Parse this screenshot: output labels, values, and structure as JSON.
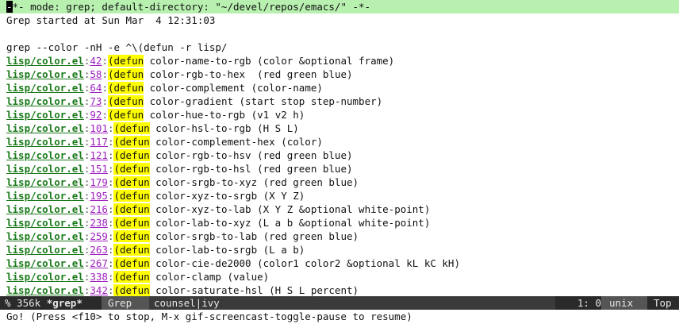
{
  "header": {
    "cursor_char": "-",
    "text": "*- mode: grep; default-directory: \"~/devel/repos/emacs/\" -*-"
  },
  "started": "Grep started at Sun Mar  4 12:31:03",
  "command": "grep --color -nH -e ^\\(defun -r lisp/",
  "results": [
    {
      "file": "lisp/color.el",
      "line": "42",
      "match": "(defun",
      "rest": " color-name-to-rgb (color &optional frame)"
    },
    {
      "file": "lisp/color.el",
      "line": "58",
      "match": "(defun",
      "rest": " color-rgb-to-hex  (red green blue)"
    },
    {
      "file": "lisp/color.el",
      "line": "64",
      "match": "(defun",
      "rest": " color-complement (color-name)"
    },
    {
      "file": "lisp/color.el",
      "line": "73",
      "match": "(defun",
      "rest": " color-gradient (start stop step-number)"
    },
    {
      "file": "lisp/color.el",
      "line": "92",
      "match": "(defun",
      "rest": " color-hue-to-rgb (v1 v2 h)"
    },
    {
      "file": "lisp/color.el",
      "line": "101",
      "match": "(defun",
      "rest": " color-hsl-to-rgb (H S L)"
    },
    {
      "file": "lisp/color.el",
      "line": "117",
      "match": "(defun",
      "rest": " color-complement-hex (color)"
    },
    {
      "file": "lisp/color.el",
      "line": "121",
      "match": "(defun",
      "rest": " color-rgb-to-hsv (red green blue)"
    },
    {
      "file": "lisp/color.el",
      "line": "151",
      "match": "(defun",
      "rest": " color-rgb-to-hsl (red green blue)"
    },
    {
      "file": "lisp/color.el",
      "line": "179",
      "match": "(defun",
      "rest": " color-srgb-to-xyz (red green blue)"
    },
    {
      "file": "lisp/color.el",
      "line": "195",
      "match": "(defun",
      "rest": " color-xyz-to-srgb (X Y Z)"
    },
    {
      "file": "lisp/color.el",
      "line": "216",
      "match": "(defun",
      "rest": " color-xyz-to-lab (X Y Z &optional white-point)"
    },
    {
      "file": "lisp/color.el",
      "line": "238",
      "match": "(defun",
      "rest": " color-lab-to-xyz (L a b &optional white-point)"
    },
    {
      "file": "lisp/color.el",
      "line": "259",
      "match": "(defun",
      "rest": " color-srgb-to-lab (red green blue)"
    },
    {
      "file": "lisp/color.el",
      "line": "263",
      "match": "(defun",
      "rest": " color-lab-to-srgb (L a b)"
    },
    {
      "file": "lisp/color.el",
      "line": "267",
      "match": "(defun",
      "rest": " color-cie-de2000 (color1 color2 &optional kL kC kH)"
    },
    {
      "file": "lisp/color.el",
      "line": "338",
      "match": "(defun",
      "rest": " color-clamp (value)"
    },
    {
      "file": "lisp/color.el",
      "line": "342",
      "match": "(defun",
      "rest": " color-saturate-hsl (H S L percent)"
    }
  ],
  "modeline": {
    "status": "% 356k",
    "buffer_name": "*grep*",
    "major_mode": "Grep",
    "minor_modes": "counsel|ivy",
    "position": "1: 0",
    "encoding": "unix",
    "scroll": "Top"
  },
  "minibuffer": "Go! (Press <f10> to stop, M-x gif-screencast-toggle-pause to resume)"
}
